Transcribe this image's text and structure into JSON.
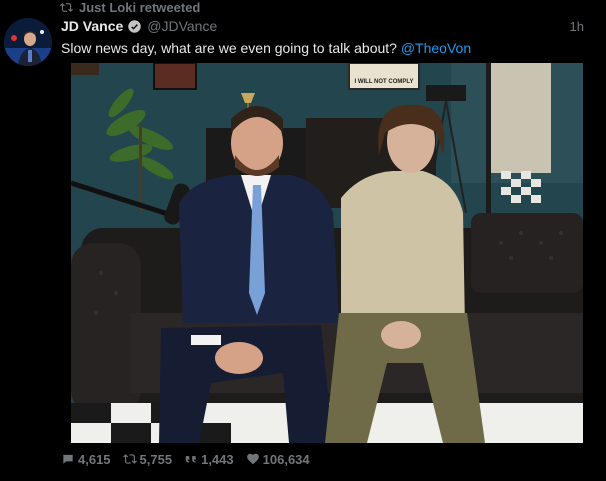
{
  "retweet": {
    "label": "Just Loki retweeted",
    "icon": "retweet-icon"
  },
  "author": {
    "name": "JD Vance",
    "handle": "@JDVance",
    "time": "1h",
    "verified_icon": "verified-badge-icon"
  },
  "tweet": {
    "text_before": "Slow news day, what are we even going to talk about? ",
    "mention": "@TheoVon"
  },
  "media": {
    "poster_text": "I WILL NOT COMPLY",
    "colors": {
      "wall": "#23454d",
      "couch": "#1e1c1b",
      "suit": "#1a2440",
      "sweater": "#cfc3a6",
      "pants": "#6f6a48"
    }
  },
  "stats": {
    "replies": "4,615",
    "retweets": "5,755",
    "quotes": "1,443",
    "likes": "106,634"
  },
  "colors": {
    "background": "#000000",
    "text": "#e7e9ea",
    "muted": "#71767b",
    "accent": "#1d9bf0"
  }
}
